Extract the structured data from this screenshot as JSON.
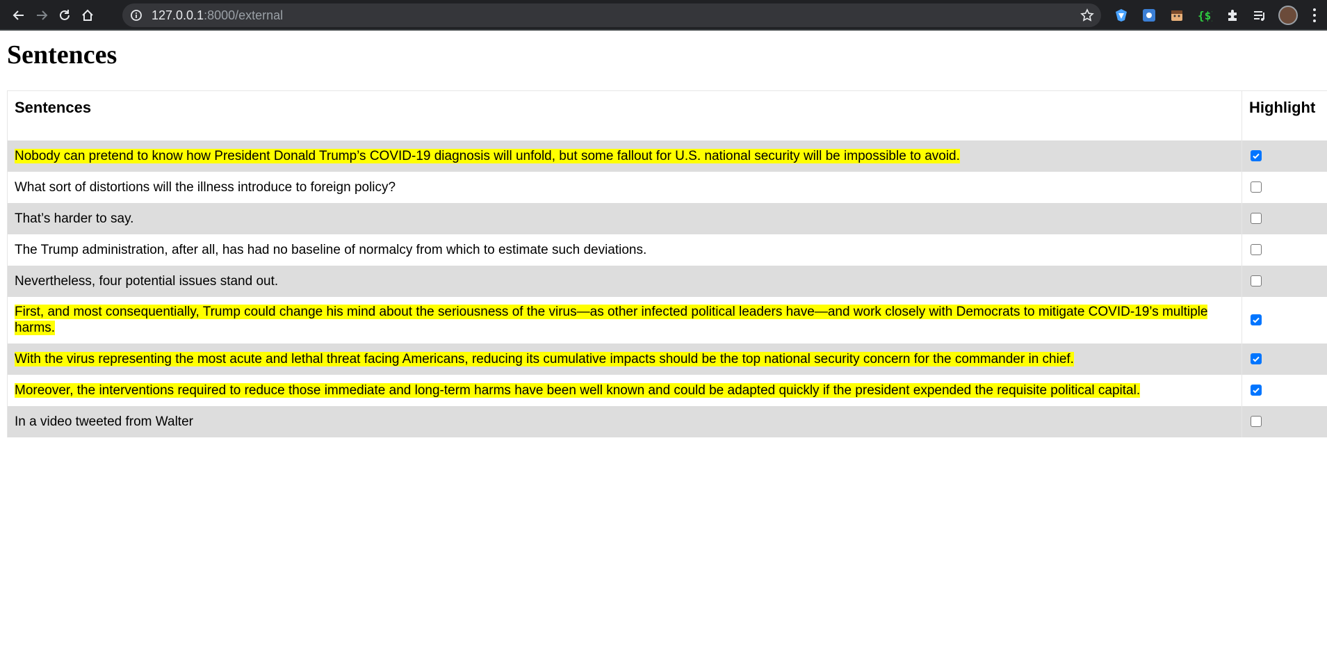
{
  "browser": {
    "url_host": "127.0.0.1",
    "url_rest": ":8000/external"
  },
  "page": {
    "title": "Sentences"
  },
  "table": {
    "headers": {
      "sentences": "Sentences",
      "highlight": "Highlight"
    },
    "rows": [
      {
        "text": "Nobody can pretend to know how President Donald Trump’s COVID-19 diagnosis will unfold, but some fallout for U.S. national security will be impossible to avoid.",
        "highlighted": true
      },
      {
        "text": "What sort of distortions will the illness introduce to foreign policy?",
        "highlighted": false
      },
      {
        "text": "That’s harder to say.",
        "highlighted": false
      },
      {
        "text": "The Trump administration, after all, has had no baseline of normalcy from which to estimate such deviations.",
        "highlighted": false
      },
      {
        "text": "Nevertheless, four potential issues stand out.",
        "highlighted": false
      },
      {
        "text": "First, and most consequentially, Trump could change his mind about the seriousness of the virus—as other infected political leaders have—and work closely with Democrats to mitigate COVID-19’s multiple harms.",
        "highlighted": true
      },
      {
        "text": "With the virus representing the most acute and lethal threat facing Americans, reducing its cumulative impacts should be the top national security concern for the commander in chief.",
        "highlighted": true
      },
      {
        "text": "Moreover, the interventions required to reduce those immediate and long-term harms have been well known and could be adapted quickly if the president expended the requisite political capital.",
        "highlighted": true
      },
      {
        "text": "In a video tweeted from Walter",
        "highlighted": false
      }
    ]
  },
  "colors": {
    "highlight": "#ffff00",
    "stripe": "#dddddd",
    "checkbox_checked": "#0075ff",
    "chrome_toolbar": "#202124"
  }
}
